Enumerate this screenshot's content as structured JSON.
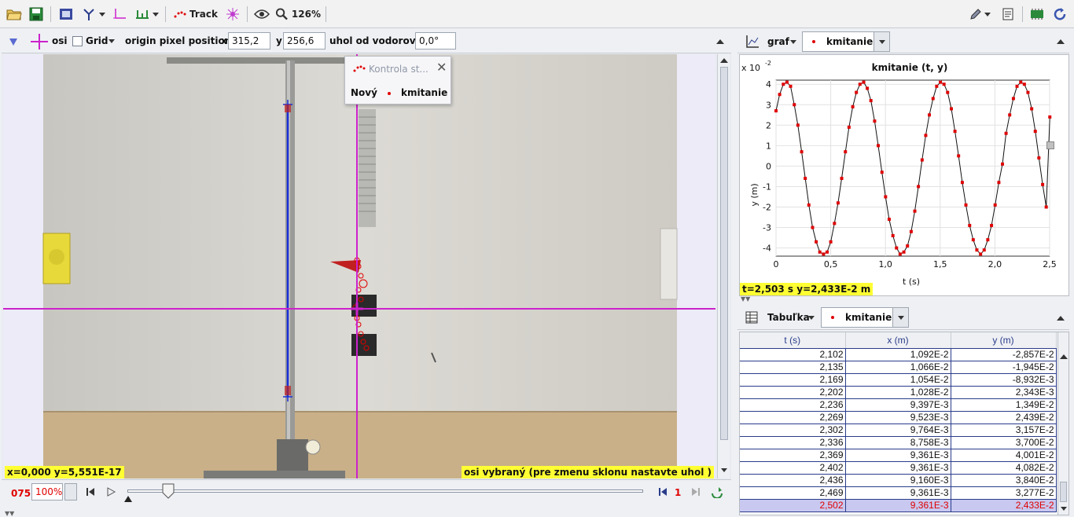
{
  "toolbar": {
    "track_label": "Track",
    "zoom_label": "126%"
  },
  "coords": {
    "axes_label": "osi",
    "grid_label": "Grid",
    "origin_label": "origin pixel position",
    "x_label": "x",
    "x_value": "315,2",
    "y_label": "y",
    "y_value": "256,6",
    "angle_label": "uhol od vodorovnej",
    "angle_value": "0,0°"
  },
  "video": {
    "status_left": "x=0,000  y=5,551E-17",
    "status_right": "osi vybraný (pre zmenu sklonu nastavte uhol )",
    "popup": {
      "title": "Kontrola st...",
      "new_label": "Nový",
      "track_name": "kmitanie"
    }
  },
  "player": {
    "frame": "075",
    "rate": "100%",
    "step": "1",
    "position": 0.08
  },
  "graph": {
    "menu_label": "graf",
    "track_name": "kmitanie",
    "status": "t=2,503 s  y=2,433E-2 m",
    "scale_label": "x 10",
    "scale_exp": "-2"
  },
  "chart_data": {
    "type": "line",
    "title": "kmitanie (t, y)",
    "xlabel": "t (s)",
    "ylabel": "y (m)",
    "xlim": [
      0,
      2.5
    ],
    "ylim": [
      -4.4,
      4.2
    ],
    "xticks": [
      "0",
      "0,5",
      "1,0",
      "1,5",
      "2,0",
      "2,5"
    ],
    "yticks": [
      "4",
      "3",
      "2",
      "1",
      "0",
      "-1",
      "-2",
      "-3",
      "-4"
    ],
    "series": [
      {
        "x": [
          0.0,
          0.033,
          0.067,
          0.1,
          0.133,
          0.167,
          0.2,
          0.234,
          0.267,
          0.3,
          0.334,
          0.367,
          0.4,
          0.434,
          0.467,
          0.5,
          0.534,
          0.567,
          0.6,
          0.634,
          0.667,
          0.701,
          0.734,
          0.767,
          0.801,
          0.834,
          0.867,
          0.901,
          0.934,
          0.968,
          1.001,
          1.034,
          1.068,
          1.101,
          1.134,
          1.168,
          1.201,
          1.235,
          1.268,
          1.301,
          1.335,
          1.368,
          1.401,
          1.435,
          1.468,
          1.502,
          1.535,
          1.568,
          1.602,
          1.635,
          1.668,
          1.702,
          1.735,
          1.769,
          1.802,
          1.835,
          1.869,
          1.902,
          1.935,
          1.969,
          2.002,
          2.036,
          2.069,
          2.102,
          2.135,
          2.169,
          2.202,
          2.236,
          2.269,
          2.302,
          2.336,
          2.369,
          2.402,
          2.436,
          2.469,
          2.502
        ],
        "values": [
          2.7,
          3.5,
          4.0,
          4.1,
          3.9,
          3.0,
          2.0,
          0.7,
          -0.6,
          -1.9,
          -3.0,
          -3.7,
          -4.2,
          -4.3,
          -4.2,
          -3.7,
          -2.8,
          -1.8,
          -0.6,
          0.7,
          1.9,
          2.9,
          3.6,
          4.0,
          4.1,
          3.8,
          3.2,
          2.2,
          1.0,
          -0.3,
          -1.5,
          -2.6,
          -3.4,
          -4.0,
          -4.3,
          -4.2,
          -3.9,
          -3.2,
          -2.2,
          -1.0,
          0.3,
          1.5,
          2.5,
          3.3,
          3.9,
          4.1,
          4.0,
          3.6,
          2.8,
          1.7,
          0.5,
          -0.8,
          -1.9,
          -2.9,
          -3.6,
          -4.1,
          -4.3,
          -4.1,
          -3.6,
          -2.9,
          -1.9,
          -0.8,
          0.1,
          1.6,
          2.5,
          3.3,
          3.9,
          4.1,
          4.0,
          3.6,
          2.8,
          1.7,
          0.4,
          -0.9,
          -2.0,
          2.4
        ]
      }
    ]
  },
  "table": {
    "menu_label": "Tabuľka",
    "track_name": "kmitanie",
    "columns": [
      "t (s)",
      "x (m)",
      "y (m)"
    ],
    "rows": [
      [
        "2,102",
        "1,092E-2",
        "-2,857E-2"
      ],
      [
        "2,135",
        "1,066E-2",
        "-1,945E-2"
      ],
      [
        "2,169",
        "1,054E-2",
        "-8,932E-3"
      ],
      [
        "2,202",
        "1,028E-2",
        "2,343E-3"
      ],
      [
        "2,236",
        "9,397E-3",
        "1,349E-2"
      ],
      [
        "2,269",
        "9,523E-3",
        "2,439E-2"
      ],
      [
        "2,302",
        "9,764E-3",
        "3,157E-2"
      ],
      [
        "2,336",
        "8,758E-3",
        "3,700E-2"
      ],
      [
        "2,369",
        "9,361E-3",
        "4,001E-2"
      ],
      [
        "2,402",
        "9,361E-3",
        "4,082E-2"
      ],
      [
        "2,436",
        "9,160E-3",
        "3,840E-2"
      ],
      [
        "2,469",
        "9,361E-3",
        "3,277E-2"
      ],
      [
        "2,502",
        "9,361E-3",
        "2,433E-2"
      ]
    ]
  },
  "colors": {
    "axes_magenta": "#cc22cc",
    "track_red": "#e00000",
    "stick_blue": "#1a2fd8",
    "status_yellow": "#ffff33"
  }
}
